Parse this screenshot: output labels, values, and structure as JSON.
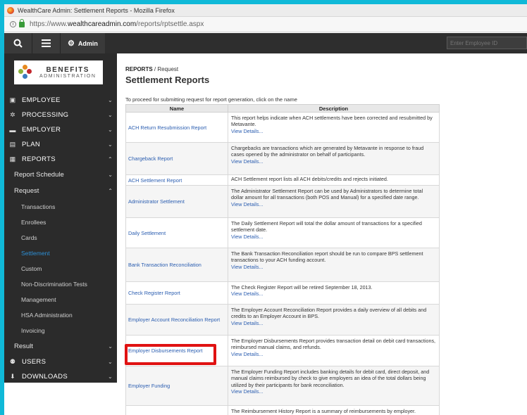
{
  "window": {
    "title": "WealthCare Admin: Settlement Reports - Mozilla Firefox"
  },
  "address": {
    "prefix": "https://www.",
    "host": "wealthcareadmin.com",
    "path": "/reports/rptsettle.aspx"
  },
  "topnav": {
    "admin_label": "Admin",
    "employee_placeholder": "Enter Employee ID"
  },
  "logo": {
    "line1": "BENEFITS",
    "line2": "ADMINISTRATION"
  },
  "sidebar": {
    "employee": "EMPLOYEE",
    "processing": "PROCESSING",
    "employer": "EMPLOYER",
    "plan": "PLAN",
    "reports": "REPORTS",
    "report_schedule": "Report Schedule",
    "request": "Request",
    "transactions": "Transactions",
    "enrollees": "Enrollees",
    "cards": "Cards",
    "settlement": "Settlement",
    "custom": "Custom",
    "nondiscrimination": "Non-Discrimination Tests",
    "management": "Management",
    "hsa": "HSA Administration",
    "invoicing": "Invoicing",
    "result": "Result",
    "users": "USERS",
    "downloads": "DOWNLOADS"
  },
  "content": {
    "crumb_root": "REPORTS",
    "crumb_leaf": "/ Request",
    "title": "Settlement Reports",
    "intro": "To proceed for submitting request for report generation, click on the name",
    "col_name": "Name",
    "col_desc": "Description",
    "view_details": "View Details...",
    "rows": [
      {
        "name": "ACH Return Resubmission Report",
        "desc": "This report helps indicate when ACH settlements have been corrected and resubmitted by Metavante."
      },
      {
        "name": "Chargeback Report",
        "desc": "Chargebacks are transactions which are generated by Metavante in response to fraud cases opened by the administrator on behalf of participants."
      },
      {
        "name": "ACH Settlement Report",
        "desc": "ACH Settlement report lists all ACH debits/credits and rejects initiated."
      },
      {
        "name": "Administrator Settlement",
        "desc": "The Administrator Settlement Report can be used by Administrators to determine total dollar amount for all transactions (both POS and Manual) for a specified date range."
      },
      {
        "name": "Daily Settlement",
        "desc": "The Daily Settlement Report will total the dollar amount of transactions for a specified settlement date."
      },
      {
        "name": "Bank Transaction Reconciliation",
        "desc": "The Bank Transaction Reconciliation report should be run to compare BPS settlement transactions to your ACH funding account."
      },
      {
        "name": "Check Register Report",
        "desc": "The Check Register Report will be retired September 18, 2013."
      },
      {
        "name": "Employer Account Reconciliation Report",
        "desc": "The Employer Account Reconciliation Report provides a daily overview of all debits and credits to an Employer Account in BPS."
      },
      {
        "name": "Employer Disbursements Report",
        "desc": "The Employer Disbursements Report provides transaction detail on debit card transactions, reimbursed manual claims, and refunds."
      },
      {
        "name": "Employer Funding",
        "desc": "The Employer Funding Report includes banking details for debit card, direct deposit, and manual claims reimbursed by check to give employers an idea of the total dollars being utilized by their participants for bank reconciliation."
      },
      {
        "name": "",
        "desc": "The Reimbursement History Report is a summary of reimbursements by employer."
      }
    ]
  },
  "colors": {
    "page_frame": "#10b9d8",
    "sidebar": "#2b2b2b",
    "active": "#2d8fd5",
    "link": "#2a5db0",
    "highlight": "#e01212"
  }
}
